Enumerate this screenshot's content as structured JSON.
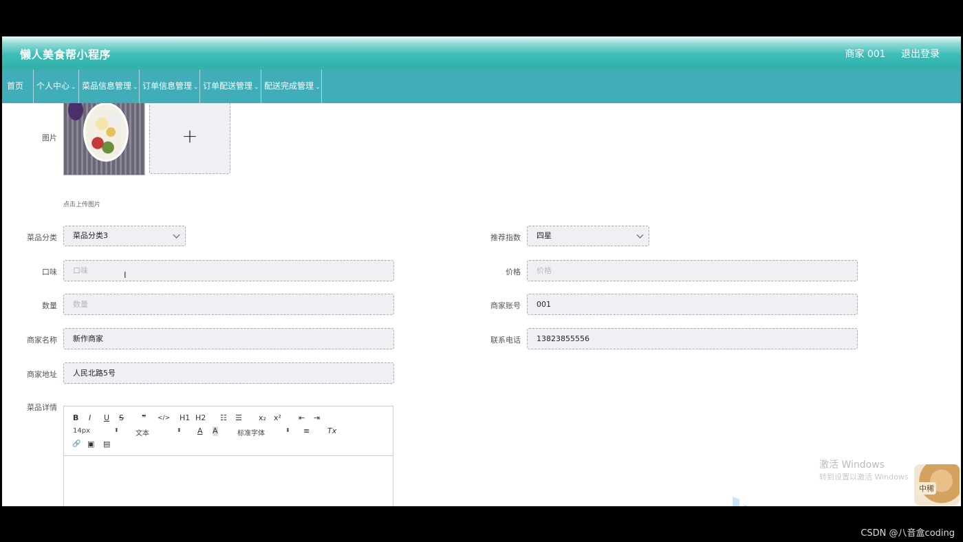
{
  "header": {
    "title": "懒人美食帮小程序",
    "user": "商家 001",
    "logout": "退出登录"
  },
  "nav": [
    {
      "label": "首页",
      "has_dropdown": false
    },
    {
      "label": "个人中心",
      "has_dropdown": true
    },
    {
      "label": "菜品信息管理",
      "has_dropdown": true
    },
    {
      "label": "订单信息管理",
      "has_dropdown": true
    },
    {
      "label": "订单配送管理",
      "has_dropdown": true
    },
    {
      "label": "配送完成管理",
      "has_dropdown": true
    }
  ],
  "form": {
    "image_label": "图片",
    "upload_plus": "+",
    "upload_hint": "点击上传图片",
    "category_label": "菜品分类",
    "category_value": "菜品分类3",
    "recommend_label": "推荐指数",
    "recommend_value": "四星",
    "taste_label": "口味",
    "taste_placeholder": "口味",
    "price_label": "价格",
    "price_placeholder": "价格",
    "quantity_label": "数量",
    "quantity_placeholder": "数量",
    "merchant_account_label": "商家账号",
    "merchant_account_value": "001",
    "merchant_name_label": "商家名称",
    "merchant_name_value": "新作商家",
    "phone_label": "联系电话",
    "phone_value": "13823855556",
    "address_label": "商家地址",
    "address_value": "人民北路5号",
    "detail_label": "菜品详情"
  },
  "editor": {
    "font_size": "14px",
    "block_type": "文本",
    "font_family": "标准字体",
    "buttons": {
      "bold": "B",
      "italic": "I",
      "underline": "U",
      "strike": "S",
      "quote": "❞",
      "code": "</>",
      "h1": "H1",
      "h2": "H2",
      "ol": "☷",
      "ul": "☰",
      "sub": "x₂",
      "sup": "x²",
      "outdent": "⇤",
      "indent": "⇥",
      "color": "A",
      "bg": "A",
      "align": "≡",
      "clear": "Tx",
      "link": "🔗",
      "image": "▣",
      "video": "▤"
    }
  },
  "overlay": {
    "activate_title": "激活 Windows",
    "activate_sub": "转到设置以激活 Windows",
    "mascot_text": "中稀",
    "credit": "CSDN @八音盒coding"
  }
}
